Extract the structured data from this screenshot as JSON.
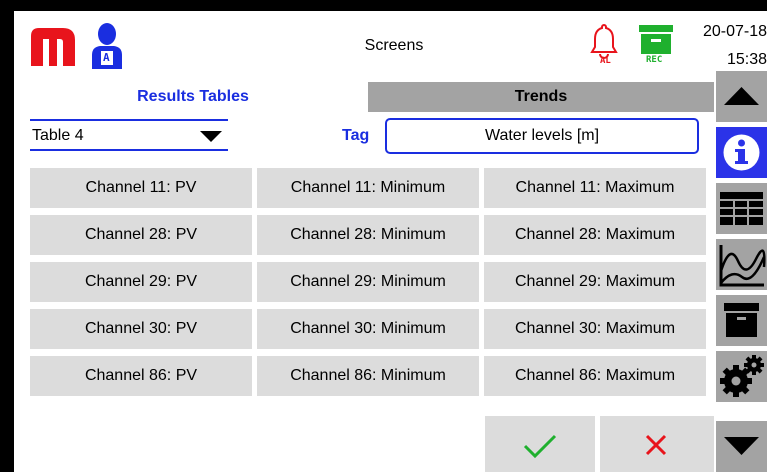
{
  "header": {
    "title": "Screens",
    "date": "20-07-18",
    "time": "15:38",
    "alarm_label": "AL",
    "rec_label": "REC",
    "user_badge": "A"
  },
  "tabs": [
    {
      "label": "Results Tables",
      "active": true
    },
    {
      "label": "Trends",
      "active": false
    }
  ],
  "table_select": {
    "value": "Table 4"
  },
  "tag": {
    "label": "Tag",
    "value": "Water levels [m]"
  },
  "grid": {
    "rows": [
      [
        "Channel 11: PV",
        "Channel 11: Minimum",
        "Channel 11: Maximum"
      ],
      [
        "Channel 28: PV",
        "Channel 28: Minimum",
        "Channel 28: Maximum"
      ],
      [
        "Channel 29: PV",
        "Channel 29: Minimum",
        "Channel 29: Maximum"
      ],
      [
        "Channel 30: PV",
        "Channel 30: Minimum",
        "Channel 30: Maximum"
      ],
      [
        "Channel 86: PV",
        "Channel 86: Minimum",
        "Channel 86: Maximum"
      ]
    ]
  },
  "toolbar": {
    "buttons": [
      "scroll-up-icon",
      "info-icon",
      "table-icon",
      "trend-icon",
      "archive-icon",
      "settings-icon",
      "scroll-down-icon"
    ]
  },
  "footer": {
    "buttons": [
      "confirm-icon",
      "cancel-icon"
    ]
  },
  "colors": {
    "accent": "#1a2ee0",
    "logo": "#e8141c",
    "rec": "#1fb02e",
    "cell_bg": "#dcdcdc",
    "tab_bg": "#a3a3a3"
  }
}
